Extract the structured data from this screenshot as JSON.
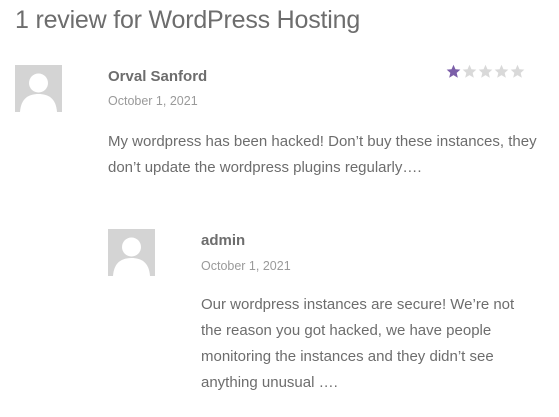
{
  "reviews_title": "1 review for WordPress Hosting",
  "review": {
    "author": "Orval Sanford",
    "date": "October 1, 2021",
    "text": "My wordpress has been hacked! Don’t buy these instances, they don’t update the wordpress plugins regularly….",
    "rating": 1,
    "rating_max": 5,
    "star_filled_color": "#7b5ea8",
    "star_empty_color": "#d9d9d9",
    "avatar_icon": "user-avatar-placeholder-icon"
  },
  "reply": {
    "author": "admin",
    "date": "October 1, 2021",
    "text": "Our wordpress instances are secure! We’re not the reason you got hacked, we have people monitoring the instances and they didn’t see anything unusual ….",
    "avatar_icon": "user-avatar-placeholder-icon"
  }
}
